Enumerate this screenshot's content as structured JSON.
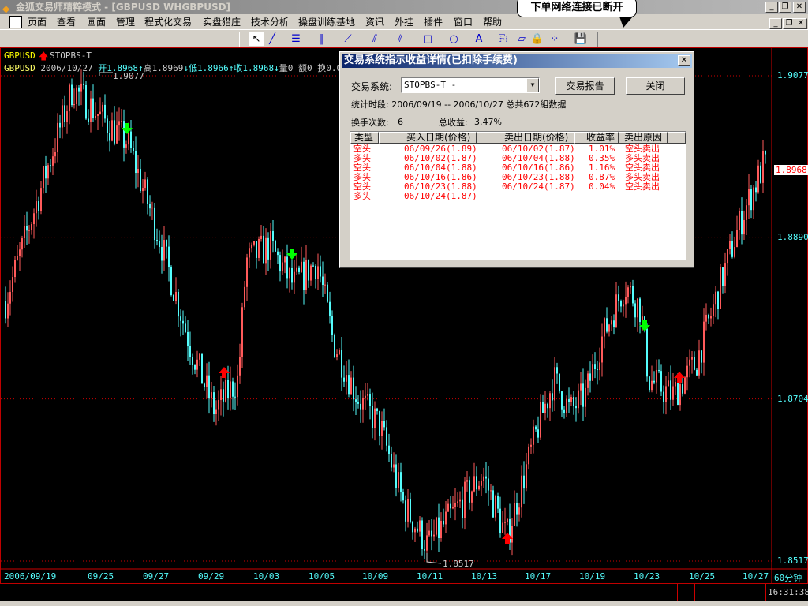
{
  "window": {
    "title": "金狐交易师精粹模式 - [GBPUSD WHGBPUSD]",
    "min": "_",
    "restore": "❐",
    "close": "✕"
  },
  "menu": [
    "页面",
    "查看",
    "画面",
    "管理",
    "程式化交易",
    "实盘猎庄",
    "技术分析",
    "操盘训练基地",
    "资讯",
    "外挂",
    "插件",
    "窗口",
    "帮助"
  ],
  "balloon": "下单网络连接已断开",
  "toolbar": {
    "icons": [
      "pointer-icon",
      "line-icon",
      "fib-icon",
      "vertical-lines-icon",
      "fan-icon",
      "channel-icon",
      "parallel-icon",
      "rectangle-icon",
      "ellipse-icon",
      "text-icon",
      "copy-icon",
      "eraser-icon",
      "lock-icon",
      "color-palette-icon",
      "save-icon"
    ]
  },
  "chart": {
    "symbol": "GBPUSD",
    "system": "STOPBS-T",
    "info": {
      "symbol": "GBPUSD",
      "date": "2006/10/27",
      "open_label": "开",
      "open": "1.8968",
      "high_label": "高",
      "high": "1.8969",
      "low_label": "低",
      "low": "1.8966",
      "close_label": "收",
      "close": "1.8968",
      "vol": "量0",
      "amt": "额0",
      "turn": "换0.0"
    },
    "high_marker": "1.9077",
    "low_marker": "1.8517",
    "price_axis": [
      "1.9077",
      "1.8890",
      "1.8704",
      "1.8517"
    ],
    "current_price": "1.8968",
    "date_axis": [
      "2006/09/19",
      "09/25",
      "09/27",
      "09/29",
      "10/03",
      "10/05",
      "10/09",
      "10/11",
      "10/13",
      "10/17",
      "10/19",
      "10/23",
      "10/25",
      "10/27"
    ],
    "period": "60分钟",
    "colors": {
      "up": "#ff5a5a",
      "down": "#54fcfc",
      "buy_signal": "#ff0000",
      "sell_signal": "#00ff00"
    },
    "price_path": [
      1.8817,
      1.9063,
      1.903,
      1.9,
      1.889,
      1.8763,
      1.869,
      1.8727,
      1.8863,
      1.8881,
      1.8835,
      1.8863,
      1.8772,
      1.8708,
      1.8672,
      1.8581,
      1.8535,
      1.8581,
      1.8617,
      1.8544,
      1.8672,
      1.8727,
      1.869,
      1.8708,
      1.8772,
      1.8836,
      1.8808,
      1.8727,
      1.8708,
      1.8745,
      1.8863,
      1.8918,
      1.8973
    ]
  },
  "status": {
    "time": "16:31:38"
  },
  "dialog": {
    "title": "交易系统指示收益详情(已扣除手续费)",
    "system_label": "交易系统:",
    "system_value": "STOPBS-T -",
    "report_button": "交易报告",
    "close_button": "关闭",
    "period_text": "统计时段: 2006/09/19 -- 2006/10/27 总共672組数据",
    "trades_label": "换手次数:",
    "trades_value": "6",
    "total_label": "总收益:",
    "total_value": "3.47%",
    "columns": [
      "类型",
      "买入日期(价格)",
      "卖出日期(价格)",
      "收益率",
      "卖出原因"
    ],
    "rows": [
      [
        "空头",
        "06/09/26(1.89)",
        "06/10/02(1.87)",
        "1.01%",
        "空头卖出"
      ],
      [
        "多头",
        "06/10/02(1.87)",
        "06/10/04(1.88)",
        "0.35%",
        "多头卖出"
      ],
      [
        "空头",
        "06/10/04(1.88)",
        "06/10/16(1.86)",
        "1.16%",
        "空头卖出"
      ],
      [
        "多头",
        "06/10/16(1.86)",
        "06/10/23(1.88)",
        "0.87%",
        "多头卖出"
      ],
      [
        "空头",
        "06/10/23(1.88)",
        "06/10/24(1.87)",
        "0.04%",
        "空头卖出"
      ],
      [
        "多头",
        "06/10/24(1.87)",
        "",
        "",
        ""
      ]
    ]
  }
}
